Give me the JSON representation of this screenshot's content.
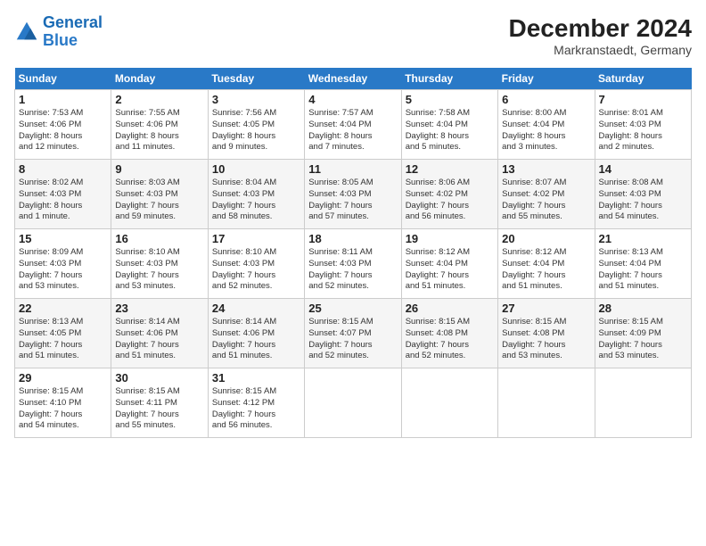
{
  "header": {
    "logo_general": "General",
    "logo_blue": "Blue",
    "month_year": "December 2024",
    "location": "Markranstaedt, Germany"
  },
  "columns": [
    "Sunday",
    "Monday",
    "Tuesday",
    "Wednesday",
    "Thursday",
    "Friday",
    "Saturday"
  ],
  "weeks": [
    [
      {
        "day": "1",
        "info": "Sunrise: 7:53 AM\nSunset: 4:06 PM\nDaylight: 8 hours\nand 12 minutes."
      },
      {
        "day": "2",
        "info": "Sunrise: 7:55 AM\nSunset: 4:06 PM\nDaylight: 8 hours\nand 11 minutes."
      },
      {
        "day": "3",
        "info": "Sunrise: 7:56 AM\nSunset: 4:05 PM\nDaylight: 8 hours\nand 9 minutes."
      },
      {
        "day": "4",
        "info": "Sunrise: 7:57 AM\nSunset: 4:04 PM\nDaylight: 8 hours\nand 7 minutes."
      },
      {
        "day": "5",
        "info": "Sunrise: 7:58 AM\nSunset: 4:04 PM\nDaylight: 8 hours\nand 5 minutes."
      },
      {
        "day": "6",
        "info": "Sunrise: 8:00 AM\nSunset: 4:04 PM\nDaylight: 8 hours\nand 3 minutes."
      },
      {
        "day": "7",
        "info": "Sunrise: 8:01 AM\nSunset: 4:03 PM\nDaylight: 8 hours\nand 2 minutes."
      }
    ],
    [
      {
        "day": "8",
        "info": "Sunrise: 8:02 AM\nSunset: 4:03 PM\nDaylight: 8 hours\nand 1 minute."
      },
      {
        "day": "9",
        "info": "Sunrise: 8:03 AM\nSunset: 4:03 PM\nDaylight: 7 hours\nand 59 minutes."
      },
      {
        "day": "10",
        "info": "Sunrise: 8:04 AM\nSunset: 4:03 PM\nDaylight: 7 hours\nand 58 minutes."
      },
      {
        "day": "11",
        "info": "Sunrise: 8:05 AM\nSunset: 4:03 PM\nDaylight: 7 hours\nand 57 minutes."
      },
      {
        "day": "12",
        "info": "Sunrise: 8:06 AM\nSunset: 4:02 PM\nDaylight: 7 hours\nand 56 minutes."
      },
      {
        "day": "13",
        "info": "Sunrise: 8:07 AM\nSunset: 4:02 PM\nDaylight: 7 hours\nand 55 minutes."
      },
      {
        "day": "14",
        "info": "Sunrise: 8:08 AM\nSunset: 4:03 PM\nDaylight: 7 hours\nand 54 minutes."
      }
    ],
    [
      {
        "day": "15",
        "info": "Sunrise: 8:09 AM\nSunset: 4:03 PM\nDaylight: 7 hours\nand 53 minutes."
      },
      {
        "day": "16",
        "info": "Sunrise: 8:10 AM\nSunset: 4:03 PM\nDaylight: 7 hours\nand 53 minutes."
      },
      {
        "day": "17",
        "info": "Sunrise: 8:10 AM\nSunset: 4:03 PM\nDaylight: 7 hours\nand 52 minutes."
      },
      {
        "day": "18",
        "info": "Sunrise: 8:11 AM\nSunset: 4:03 PM\nDaylight: 7 hours\nand 52 minutes."
      },
      {
        "day": "19",
        "info": "Sunrise: 8:12 AM\nSunset: 4:04 PM\nDaylight: 7 hours\nand 51 minutes."
      },
      {
        "day": "20",
        "info": "Sunrise: 8:12 AM\nSunset: 4:04 PM\nDaylight: 7 hours\nand 51 minutes."
      },
      {
        "day": "21",
        "info": "Sunrise: 8:13 AM\nSunset: 4:04 PM\nDaylight: 7 hours\nand 51 minutes."
      }
    ],
    [
      {
        "day": "22",
        "info": "Sunrise: 8:13 AM\nSunset: 4:05 PM\nDaylight: 7 hours\nand 51 minutes."
      },
      {
        "day": "23",
        "info": "Sunrise: 8:14 AM\nSunset: 4:06 PM\nDaylight: 7 hours\nand 51 minutes."
      },
      {
        "day": "24",
        "info": "Sunrise: 8:14 AM\nSunset: 4:06 PM\nDaylight: 7 hours\nand 51 minutes."
      },
      {
        "day": "25",
        "info": "Sunrise: 8:15 AM\nSunset: 4:07 PM\nDaylight: 7 hours\nand 52 minutes."
      },
      {
        "day": "26",
        "info": "Sunrise: 8:15 AM\nSunset: 4:08 PM\nDaylight: 7 hours\nand 52 minutes."
      },
      {
        "day": "27",
        "info": "Sunrise: 8:15 AM\nSunset: 4:08 PM\nDaylight: 7 hours\nand 53 minutes."
      },
      {
        "day": "28",
        "info": "Sunrise: 8:15 AM\nSunset: 4:09 PM\nDaylight: 7 hours\nand 53 minutes."
      }
    ],
    [
      {
        "day": "29",
        "info": "Sunrise: 8:15 AM\nSunset: 4:10 PM\nDaylight: 7 hours\nand 54 minutes."
      },
      {
        "day": "30",
        "info": "Sunrise: 8:15 AM\nSunset: 4:11 PM\nDaylight: 7 hours\nand 55 minutes."
      },
      {
        "day": "31",
        "info": "Sunrise: 8:15 AM\nSunset: 4:12 PM\nDaylight: 7 hours\nand 56 minutes."
      },
      null,
      null,
      null,
      null
    ]
  ]
}
